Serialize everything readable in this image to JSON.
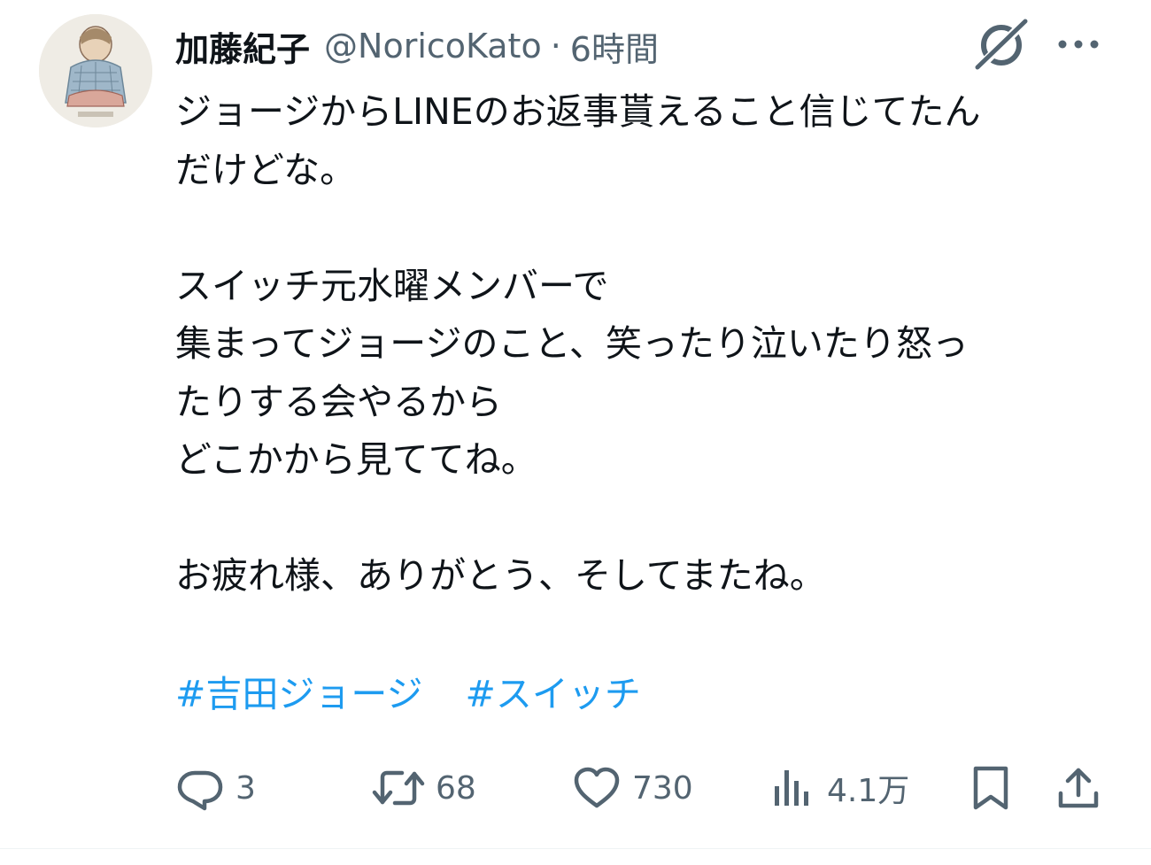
{
  "author": {
    "display_name": "加藤紀子",
    "handle": "@NoricoKato",
    "separator": "·",
    "timestamp": "6時間"
  },
  "tweet": {
    "text": "ジョージからLINEのお返事貰えること信じてたん\nだけどな。\n\nスイッチ元水曜メンバーで\n集まってジョージのこと、笑ったり泣いたり怒っ\nたりする会やるから\nどこかから見ててね。\n\nお疲れ様、ありがとう、そしてまたね。",
    "hashtags": [
      "#吉田ジョージ",
      "#スイッチ"
    ]
  },
  "actions": {
    "reply_count": "3",
    "retweet_count": "68",
    "like_count": "730",
    "views_count": "4.1万"
  },
  "icons": {
    "grok": "grok-icon",
    "more": "more-icon",
    "reply": "reply-icon",
    "retweet": "retweet-icon",
    "like": "heart-icon",
    "views": "views-icon",
    "bookmark": "bookmark-icon",
    "share": "share-icon"
  },
  "colors": {
    "text": "#0f1419",
    "secondary": "#536471",
    "link": "#1d9bf0"
  }
}
